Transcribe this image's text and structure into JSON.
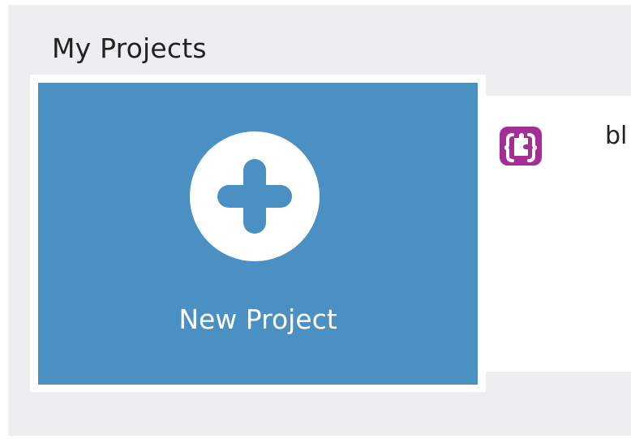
{
  "section": {
    "title": "My Projects"
  },
  "new_project": {
    "label": "New Project",
    "icon": "plus-icon"
  },
  "projects": [
    {
      "name": "bl",
      "icon": "puzzle-braces-icon",
      "icon_color": "#a22e96"
    }
  ],
  "colors": {
    "background": "#eceef0",
    "tile": "#4a90c2",
    "card": "#ffffff"
  }
}
